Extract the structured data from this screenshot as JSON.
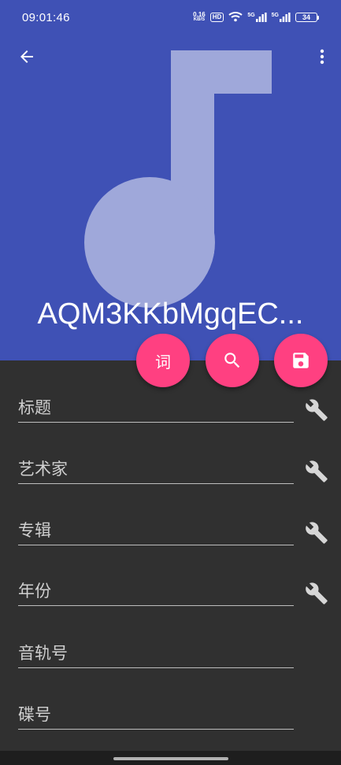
{
  "status_bar": {
    "time": "09:01:46",
    "net_speed_value": "0.16",
    "net_speed_unit": "KB/S",
    "hd_label": "HD",
    "signal1_label": "5G",
    "signal2_label": "5G",
    "battery_level": "34"
  },
  "header": {
    "song_title": "AQM3KKbMgqEC...",
    "background_color": "#3F51B5",
    "art_color": "#9FA8DA"
  },
  "fabs": {
    "lyrics_label": "词",
    "accent_color": "#FF4081"
  },
  "fields": [
    {
      "placeholder": "标题",
      "has_tool": true
    },
    {
      "placeholder": "艺术家",
      "has_tool": true
    },
    {
      "placeholder": "专辑",
      "has_tool": true
    },
    {
      "placeholder": "年份",
      "has_tool": true
    },
    {
      "placeholder": "音轨号",
      "has_tool": false
    },
    {
      "placeholder": "碟号",
      "has_tool": false
    }
  ]
}
